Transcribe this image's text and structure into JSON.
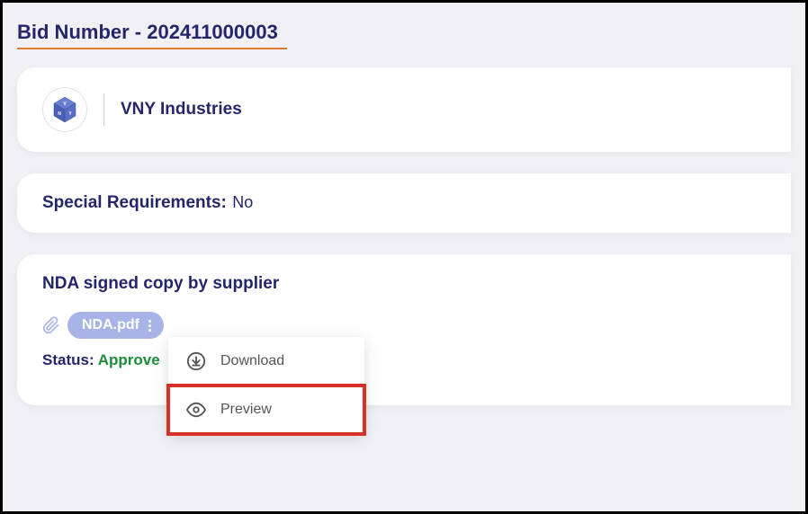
{
  "header": {
    "title_prefix": "Bid Number - ",
    "bid_number": "202411000003"
  },
  "company": {
    "name": "VNY Industries"
  },
  "special_requirements": {
    "label": "Special Requirements:",
    "value": "No"
  },
  "nda": {
    "title": "NDA signed copy by supplier",
    "file_name": "NDA.pdf",
    "status_label": "Status:",
    "status_value": "Approve",
    "menu": {
      "download": "Download",
      "preview": "Preview"
    }
  }
}
